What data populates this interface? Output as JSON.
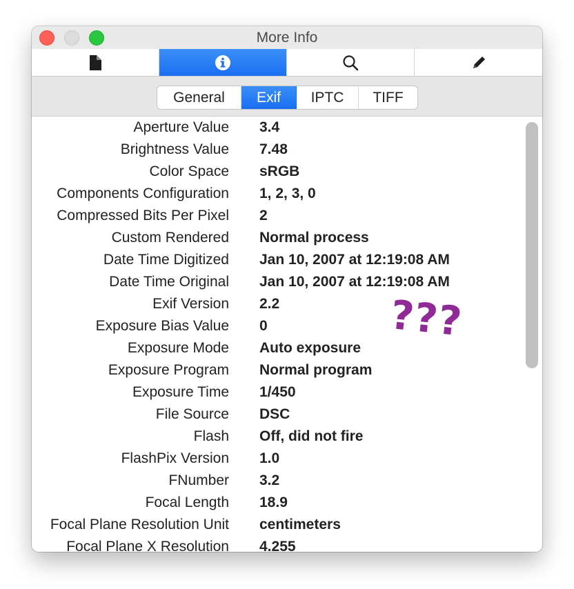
{
  "window": {
    "title": "More Info"
  },
  "toolbar": {
    "items": [
      {
        "icon": "document-icon",
        "active": false
      },
      {
        "icon": "info-icon",
        "active": true
      },
      {
        "icon": "search-icon",
        "active": false
      },
      {
        "icon": "pencil-icon",
        "active": false
      }
    ]
  },
  "tabs": [
    {
      "label": "General",
      "active": false
    },
    {
      "label": "Exif",
      "active": true
    },
    {
      "label": "IPTC",
      "active": false
    },
    {
      "label": "TIFF",
      "active": false
    }
  ],
  "exif": [
    {
      "label": "Aperture Value",
      "value": "3.4"
    },
    {
      "label": "Brightness Value",
      "value": "7.48"
    },
    {
      "label": "Color Space",
      "value": "sRGB"
    },
    {
      "label": "Components Configuration",
      "value": "1, 2, 3, 0"
    },
    {
      "label": "Compressed Bits Per Pixel",
      "value": "2"
    },
    {
      "label": "Custom Rendered",
      "value": "Normal process"
    },
    {
      "label": "Date Time Digitized",
      "value": "Jan 10, 2007 at 12:19:08 AM"
    },
    {
      "label": "Date Time Original",
      "value": "Jan 10, 2007 at 12:19:08 AM"
    },
    {
      "label": "Exif Version",
      "value": "2.2"
    },
    {
      "label": "Exposure Bias Value",
      "value": "0"
    },
    {
      "label": "Exposure Mode",
      "value": "Auto exposure"
    },
    {
      "label": "Exposure Program",
      "value": "Normal program"
    },
    {
      "label": "Exposure Time",
      "value": "1/450"
    },
    {
      "label": "File Source",
      "value": "DSC"
    },
    {
      "label": "Flash",
      "value": "Off, did not fire"
    },
    {
      "label": "FlashPix Version",
      "value": "1.0"
    },
    {
      "label": "FNumber",
      "value": "3.2"
    },
    {
      "label": "Focal Length",
      "value": "18.9"
    },
    {
      "label": "Focal Plane Resolution Unit",
      "value": "centimeters"
    },
    {
      "label": "Focal Plane X Resolution",
      "value": "4.255"
    }
  ],
  "annotation": {
    "text": "???",
    "color": "#8f2a97"
  },
  "colors": {
    "accent": "#1a6ff3",
    "close": "#fe5f57",
    "zoom": "#29c840"
  }
}
